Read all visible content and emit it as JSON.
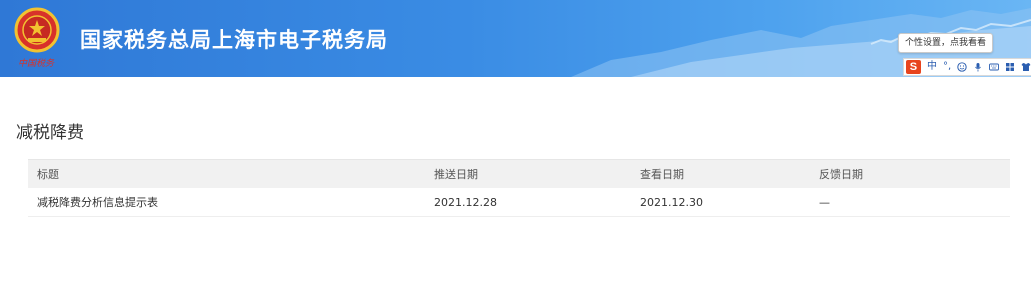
{
  "header": {
    "site_title": "国家税务总局上海市电子税务局",
    "emblem_caption": "中国税务",
    "colors": {
      "bar_start": "#2f78d6",
      "bar_end": "#6ab6f4"
    }
  },
  "ime": {
    "tooltip": "个性设置，点我看看",
    "logo": "S",
    "mode": "中",
    "punct": "°,",
    "icons": [
      "smiley-icon",
      "mic-icon",
      "keyboard-icon",
      "grid-icon",
      "shirt-icon",
      "apps-icon"
    ]
  },
  "page": {
    "heading": "减税降费"
  },
  "table": {
    "columns": [
      "标题",
      "推送日期",
      "查看日期",
      "反馈日期"
    ],
    "rows": [
      {
        "title": "减税降费分析信息提示表",
        "push_date": "2021.12.28",
        "view_date": "2021.12.30",
        "feedback_date": "—"
      }
    ]
  }
}
